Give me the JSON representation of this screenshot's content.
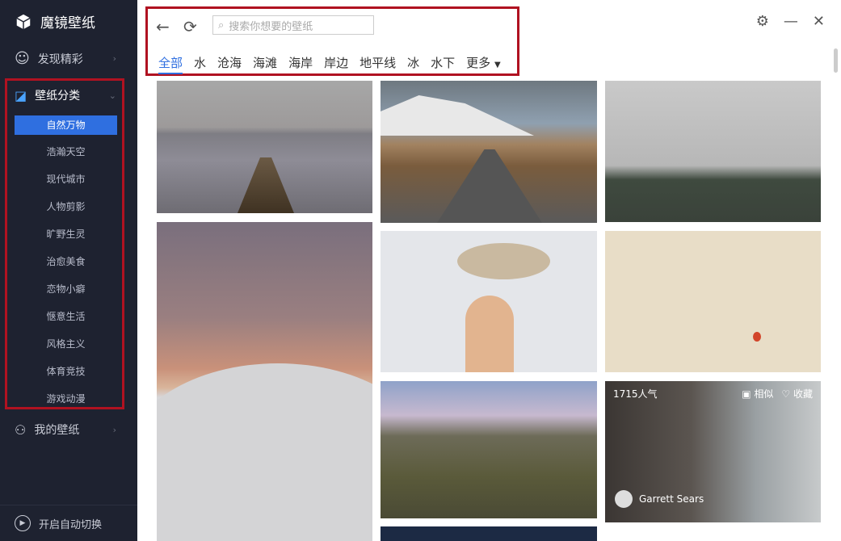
{
  "app": {
    "name": "魔镜壁纸"
  },
  "sidebar": {
    "discover": "发现精彩",
    "categories_label": "壁纸分类",
    "sub": [
      "自然万物",
      "浩瀚天空",
      "现代城市",
      "人物剪影",
      "旷野生灵",
      "治愈美食",
      "恋物小癖",
      "惬意生活",
      "风格主义",
      "体育竞技",
      "游戏动漫"
    ],
    "my_wallpapers": "我的壁纸",
    "auto_switch": "开启自动切换"
  },
  "search": {
    "placeholder": "搜索你想要的壁纸"
  },
  "tabs": [
    "全部",
    "水",
    "沧海",
    "海滩",
    "海岸",
    "岸边",
    "地平线",
    "冰",
    "水下",
    "更多"
  ],
  "tile": {
    "popularity": "1715人气",
    "similar": "相似",
    "favorite": "收藏",
    "author": "Garrett Sears"
  },
  "colors": {
    "accent": "#2f6fe0",
    "highlight": "#b01221",
    "sidebar_bg": "#1e2230"
  }
}
